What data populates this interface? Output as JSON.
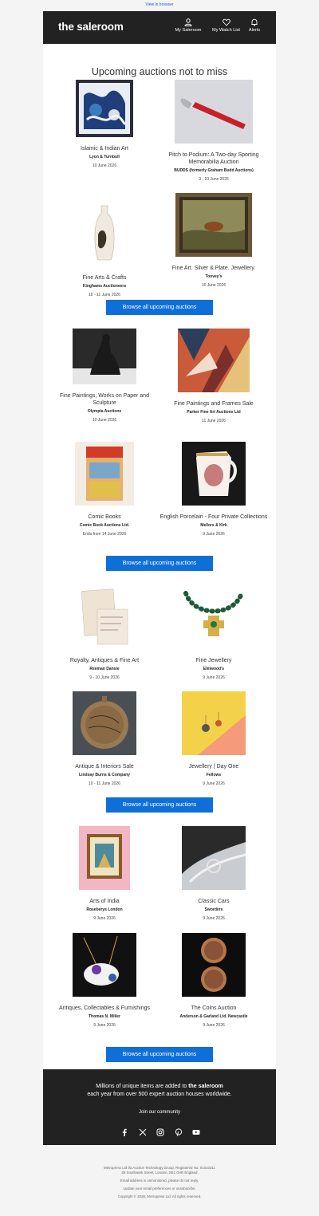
{
  "top": {
    "view_in_browser": "View in browser"
  },
  "header": {
    "logo": "the saleroom",
    "nav": [
      {
        "label": "My Saleroom"
      },
      {
        "label": "My Watch List"
      },
      {
        "label": "Alerts"
      }
    ]
  },
  "title": "Upcoming auctions not to miss",
  "browse_label": "Browse all upcoming auctions",
  "auctions": [
    {
      "name": "Islamic & Indian Art",
      "house": "Lyon & Turnbull",
      "date": "10 June 2026"
    },
    {
      "name": "Pitch to Podium: A Two-day Sporting Memorabilia Auction",
      "house": "BUDDS (formerly Graham Budd Auctions)",
      "date": "9 - 10 June 2026"
    },
    {
      "name": "Fine Arts & Crafts",
      "house": "Kinghams Auctioneers",
      "date": "10 - 11 June 2026"
    },
    {
      "name": "Fine Art. Silver & Plate. Jewellery.",
      "house": "Toovey's",
      "date": "10 June 2026"
    },
    {
      "name": "Fine Paintings, Works on Paper and Sculpture",
      "house": "Olympia Auctions",
      "date": "10 June 2026"
    },
    {
      "name": "Fine Paintings and Frames Sale",
      "house": "Parker Fine Art Auctions Ltd",
      "date": "11 June 2026"
    },
    {
      "name": "Comic Books",
      "house": "Comic Book Auctions Ltd.",
      "date": "Ends from 14 June 2026"
    },
    {
      "name": "English Porcelain - Four Private Collections",
      "house": "Mellors & Kirk",
      "date": "9 June 2026"
    },
    {
      "name": "Royalty, Antiques & Fine Art",
      "house": "Reeman Dansie",
      "date": "9 - 10 June 2026"
    },
    {
      "name": "Fine Jewellery",
      "house": "Elmwood's",
      "date": "9 June 2026"
    },
    {
      "name": "Antique & Interiors Sale",
      "house": "Lindsay Burns & Company",
      "date": "10 - 11 June 2026"
    },
    {
      "name": "Jewellery | Day One",
      "house": "Fellows",
      "date": "9 June 2026"
    },
    {
      "name": "Arts of India",
      "house": "Roseberys London",
      "date": "9 June 2026"
    },
    {
      "name": "Classic Cars",
      "house": "Sworders",
      "date": "9 June 2026"
    },
    {
      "name": "Antiques, Collectables & Furnishings",
      "house": "Thomas N. Miller",
      "date": "9 June 2026"
    },
    {
      "name": "The Coins Auction",
      "house": "Anderson & Garland Ltd. Newcastle",
      "date": "9 June 2026"
    }
  ],
  "footer": {
    "text_pre": "Millions of unique items are added to ",
    "text_brand": "the saleroom",
    "text_post": "each year from over 500 expert auction houses worldwide.",
    "join": "Join our community",
    "socials": [
      "facebook-icon",
      "x-icon",
      "instagram-icon",
      "pinterest-icon",
      "youtube-icon"
    ]
  },
  "legal": {
    "line1": "Metropress Ltd t/a Auction Technology Group. Registered No: 01010311",
    "line2": "65 Southwark Street, London, SE1 0HR England",
    "line3": "Email address is unmonitored, please do not reply.",
    "line4": "Update your email preferences or unsubscribe.",
    "line5": "Copyright © 2026, Metropress Ltd. All rights reserved."
  },
  "colors": {
    "header_bg": "#222222",
    "button_bg": "#0f6fd9",
    "link": "#1a5fd6"
  }
}
